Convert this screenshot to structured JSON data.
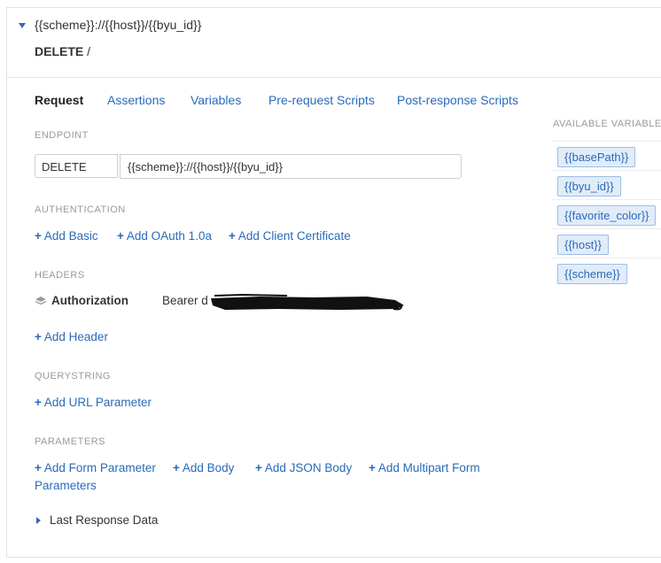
{
  "header": {
    "url": "{{scheme}}://{{host}}/{{byu_id}}",
    "method": "DELETE",
    "path": "/"
  },
  "tabs": [
    "Request",
    "Assertions",
    "Variables",
    "Pre-request Scripts",
    "Post-response Scripts"
  ],
  "endpoint": {
    "label": "ENDPOINT",
    "method": "DELETE",
    "url": "{{scheme}}://{{host}}/{{byu_id}}"
  },
  "authentication": {
    "label": "AUTHENTICATION",
    "add_basic": "Add Basic",
    "add_oauth": "Add OAuth 1.0a",
    "add_cert": "Add Client Certificate"
  },
  "headers": {
    "label": "HEADERS",
    "auth_name": "Authorization",
    "auth_value": "Bearer d",
    "add_header": "Add Header"
  },
  "querystring": {
    "label": "QUERYSTRING",
    "add_param": "Add URL Parameter"
  },
  "parameters": {
    "label": "PARAMETERS",
    "add_form_line1": "Add Form Parameter",
    "add_form_line2": "Parameters",
    "add_body": "Add Body",
    "add_json": "Add JSON Body",
    "add_multipart": "Add Multipart Form"
  },
  "last_response": "Last Response Data",
  "variables": {
    "label": "AVAILABLE VARIABLES",
    "items": [
      "{{basePath}}",
      "{{byu_id}}",
      "{{favorite_color}}",
      "{{host}}",
      "{{scheme}}"
    ]
  },
  "colors": {
    "link": "#2a6ab8",
    "chip_bg": "#e1ecf9",
    "chip_border": "#9dbde4",
    "label_gray": "#9a9a9a"
  }
}
